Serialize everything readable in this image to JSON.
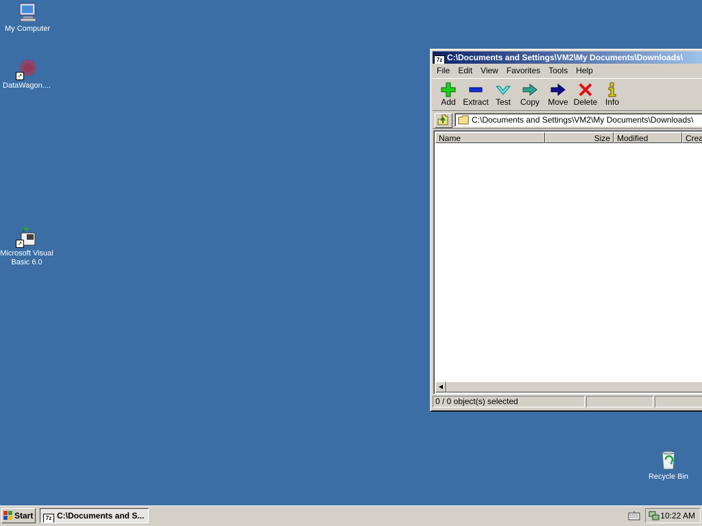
{
  "desktop": {
    "background_color": "#3a6ea5",
    "icons": [
      {
        "label": "My Computer",
        "icon": "my-computer-icon"
      },
      {
        "label": "DataWagon....",
        "icon": "datawagon-icon"
      },
      {
        "label": "Microsoft Visual Basic 6.0",
        "icon": "visual-basic-icon"
      },
      {
        "label": "Recycle Bin",
        "icon": "recycle-bin-icon"
      }
    ]
  },
  "window": {
    "app_icon_text": "7z",
    "title": "C:\\Documents and Settings\\VM2\\My Documents\\Downloads\\",
    "menu": [
      "File",
      "Edit",
      "View",
      "Favorites",
      "Tools",
      "Help"
    ],
    "toolbar": [
      {
        "label": "Add",
        "icon": "add-icon",
        "color": "#00c000"
      },
      {
        "label": "Extract",
        "icon": "extract-icon",
        "color": "#0000c0"
      },
      {
        "label": "Test",
        "icon": "test-icon",
        "color": "#20b8b8"
      },
      {
        "label": "Copy",
        "icon": "copy-icon",
        "color": "#208070"
      },
      {
        "label": "Move",
        "icon": "move-icon",
        "color": "#000080"
      },
      {
        "label": "Delete",
        "icon": "delete-icon",
        "color": "#e00000"
      },
      {
        "label": "Info",
        "icon": "info-icon",
        "color": "#c0c000"
      }
    ],
    "address": "C:\\Documents and Settings\\VM2\\My Documents\\Downloads\\",
    "columns": [
      "Name",
      "Size",
      "Modified",
      "Creat"
    ],
    "status": "0 / 0 object(s) selected"
  },
  "taskbar": {
    "start_label": "Start",
    "task_icon_text": "7z",
    "task_label": "C:\\Documents and S...",
    "clock": "10:22 AM"
  }
}
